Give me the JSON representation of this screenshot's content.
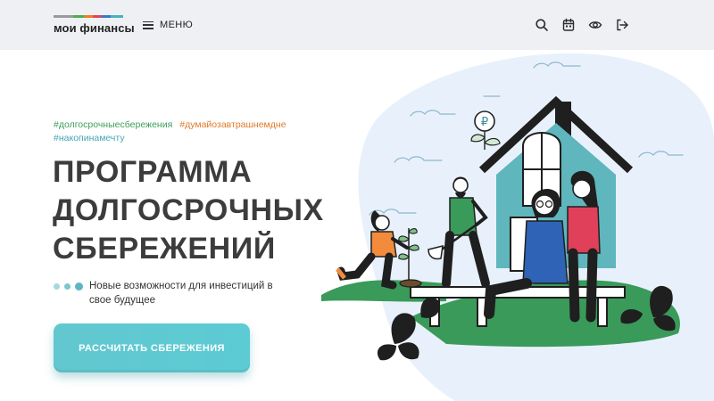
{
  "header": {
    "logo_text": "мои финансы",
    "logo_stripe_colors": [
      "#9a9a9a",
      "#4caf50",
      "#ef7d22",
      "#e2445c",
      "#3c78c8",
      "#45b3c0"
    ],
    "menu_label": "МЕНЮ",
    "icons": [
      "search-icon",
      "calendar-icon",
      "eye-icon",
      "login-icon"
    ]
  },
  "hero": {
    "tags": [
      {
        "text": "#долгосрочныесбережения",
        "color": "#3e9e58"
      },
      {
        "text": "#думайозавтрашнемдне",
        "color": "#e07b2a"
      },
      {
        "text": "#накопинамечту",
        "color": "#45a5b5"
      }
    ],
    "title_lines": [
      "ПРОГРАММА",
      "ДОЛГОСРОЧНЫХ",
      "СБЕРЕЖЕНИЙ"
    ],
    "subtitle": "Новые возможности для инвестиций в свое будущее",
    "cta_label": "РАССЧИТАТЬ СБЕРЕЖЕНИЯ",
    "ruble_sign": "₽"
  },
  "colors": {
    "header_bg": "#eef0f4",
    "accent": "#5ccbd4",
    "title": "#3c3c3c",
    "house": "#5fb6bd",
    "grass": "#3a9a5a",
    "blob": "#e8f1fb"
  }
}
